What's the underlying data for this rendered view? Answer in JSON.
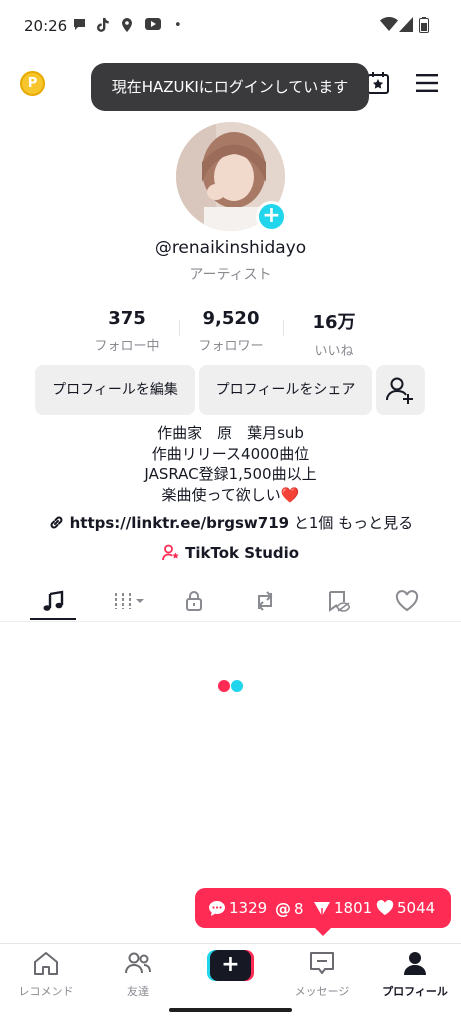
{
  "status_bar": {
    "time": "20:26",
    "dot": "•",
    "left_icons": [
      "chat-bubble-icon",
      "tiktok-icon",
      "location-icon",
      "youtube-icon"
    ],
    "right_icons": [
      "wifi-icon",
      "signal-icon",
      "battery-icon"
    ]
  },
  "top_nav": {
    "coin_glyph": "P",
    "toast": "現在HAZUKIにログインしています"
  },
  "profile": {
    "username": "@renaikinshidayo",
    "category": "アーティスト"
  },
  "stats": [
    {
      "value": "375",
      "label": "フォロー中"
    },
    {
      "value": "9,520",
      "label": "フォロワー"
    },
    {
      "value": "16万",
      "label": "いいね"
    }
  ],
  "buttons": {
    "edit_profile": "プロフィールを編集",
    "share_profile": "プロフィールをシェア"
  },
  "bio": {
    "line1": "作曲家　原　葉月sub",
    "line2": "作曲リリース4000曲位",
    "line3": "JASRAC登録1,500曲以上",
    "line4": "楽曲使って欲しい",
    "heart": "❤️"
  },
  "link": {
    "url": "https://linktr.ee/brgsw719",
    "more": " と1個 もっと見る"
  },
  "studio": {
    "label": "TikTok Studio"
  },
  "tabs": [
    {
      "name": "music",
      "active": true
    },
    {
      "name": "playlists",
      "active": false
    },
    {
      "name": "private",
      "active": false
    },
    {
      "name": "reposts",
      "active": false
    },
    {
      "name": "favorites",
      "active": false
    },
    {
      "name": "liked",
      "active": false
    }
  ],
  "activity": {
    "comments": "1329",
    "mentions": "8",
    "shares": "1801",
    "likes": "5044"
  },
  "bottom_nav": {
    "home": "レコメンド",
    "friends": "友達",
    "create": "+",
    "inbox": "メッセージ",
    "profile": "プロフィール"
  },
  "colors": {
    "accent": "#fe2c55",
    "cyan": "#20d5ec",
    "text": "#161823",
    "muted": "#8a8b91",
    "button_bg": "#efeff0"
  }
}
